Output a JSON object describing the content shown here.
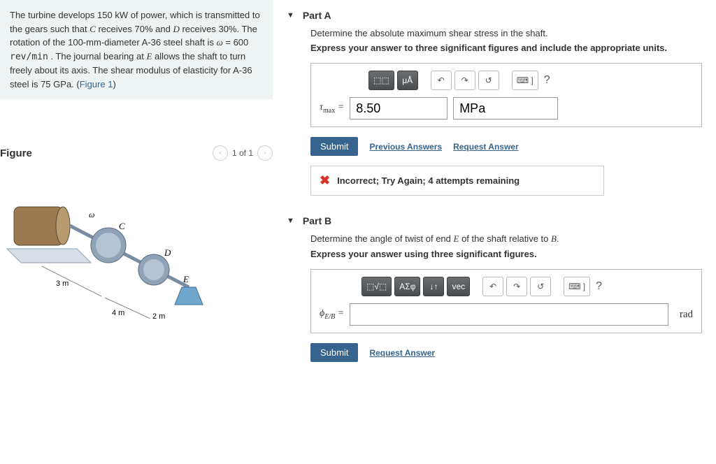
{
  "problem": {
    "text_before_power": "The turbine develops 150 ",
    "power_unit": "kW",
    "text_after_power": " of power, which is transmitted to the gears such that ",
    "gear_c": "C",
    "text_c_pct": " receives 70% and ",
    "gear_d": "D",
    "text_d_pct": " receives 30%. The rotation of the 100-",
    "mm": "mm",
    "text_diameter": "-diameter A-36 steel shaft is ",
    "omega": "ω",
    "eq": " = 600 ",
    "rev_unit": "rev/min",
    "text_journal": " . The journal bearing at ",
    "bearing_e": "E",
    "text_after_e": " allows the shaft to turn freely about its axis. The shear modulus of elasticity for A-36 steel is 75 ",
    "gpa": "GPa",
    "text_end": ". (",
    "fig_link": "Figure 1",
    "text_close": ")"
  },
  "figure": {
    "title": "Figure",
    "counter": "1 of 1",
    "labels": {
      "C": "C",
      "D": "D",
      "E": "E",
      "d1": "3 m",
      "d2": "4 m",
      "d3": "2 m",
      "omega": "ω"
    }
  },
  "partA": {
    "title": "Part A",
    "prompt": "Determine the absolute maximum shear stress in the shaft.",
    "instr": "Express your answer to three significant figures and include the appropriate units.",
    "toolbar": {
      "templates": "⬚⬚",
      "mu": "μÅ",
      "undo": "↶",
      "redo": "↷",
      "reset": "↺",
      "keyboard": "⌨ ]",
      "help": "?"
    },
    "label": "τmax = ",
    "value": "8.50",
    "unit": "MPa",
    "submit": "Submit",
    "prev_answers": "Previous Answers",
    "request": "Request Answer",
    "feedback": "Incorrect; Try Again; 4 attempts remaining"
  },
  "partB": {
    "title": "Part B",
    "prompt_before": "Determine the angle of twist of end ",
    "prompt_e": "E",
    "prompt_mid": " of the shaft relative to ",
    "prompt_b": "B",
    "prompt_after": ".",
    "instr": "Express your answer using three significant figures.",
    "toolbar": {
      "templates": "⬚√⬚",
      "greek": "ΑΣφ",
      "sort": "↓↑",
      "vec": "vec",
      "undo": "↶",
      "redo": "↷",
      "reset": "↺",
      "keyboard": "⌨ ]",
      "help": "?"
    },
    "label": "ϕE/B = ",
    "value": "",
    "unit_suffix": "rad",
    "submit": "Submit",
    "request": "Request Answer"
  }
}
